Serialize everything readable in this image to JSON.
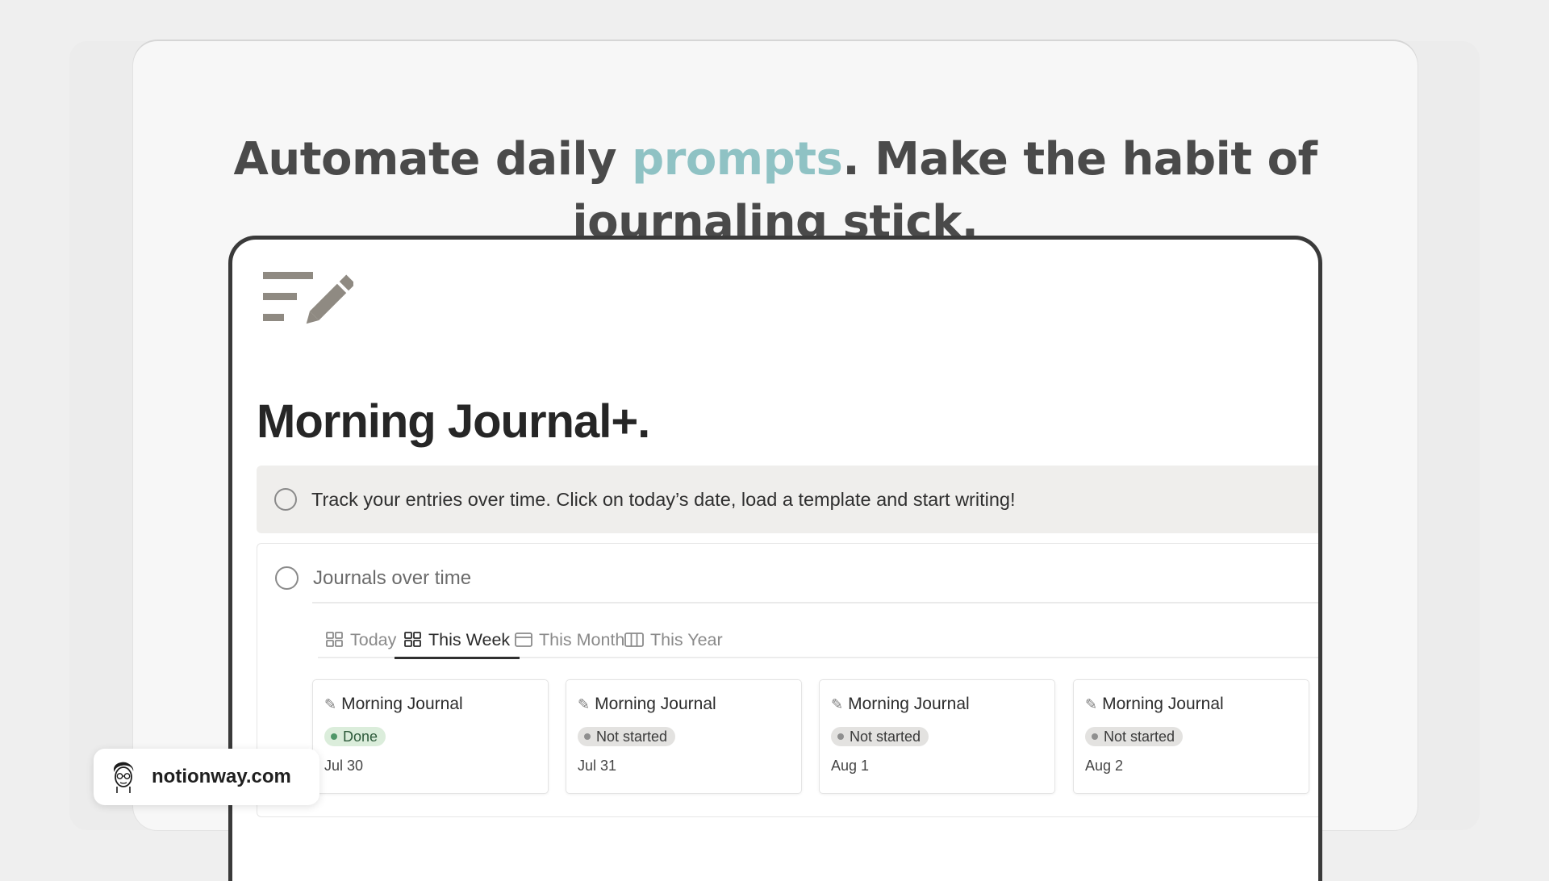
{
  "headline": {
    "part1": "Automate daily ",
    "accent": "prompts",
    "part2": ". Make the habit of",
    "line2": "journaling stick."
  },
  "colors": {
    "accent": "#8fc2c4",
    "done_badge_bg": "#dbeddb",
    "not_started_badge_bg": "#e3e2e0"
  },
  "app": {
    "page_icon": "pencil-lines-icon",
    "page_title": "Morning Journal+.",
    "callout": {
      "icon": "circle-icon",
      "text": "Track your entries over time. Click on today’s date, load a template and start writing!"
    },
    "database": {
      "title": "Journals over time",
      "tabs": [
        {
          "label": "Today",
          "icon": "gallery-icon",
          "active": false
        },
        {
          "label": "This Week",
          "icon": "gallery-icon",
          "active": true
        },
        {
          "label": "This Month",
          "icon": "calendar-icon",
          "active": false
        },
        {
          "label": "This Year",
          "icon": "board-icon",
          "active": false
        }
      ],
      "cards": [
        {
          "title": "Morning Journal",
          "status": "Done",
          "date": "Jul 30"
        },
        {
          "title": "Morning Journal",
          "status": "Not started",
          "date": "Jul 31"
        },
        {
          "title": "Morning Journal",
          "status": "Not started",
          "date": "Aug 1"
        },
        {
          "title": "Morning Journal",
          "status": "Not started",
          "date": "Aug 2"
        }
      ]
    }
  },
  "brand": {
    "avatar": "avatar-icon",
    "text": "notionway.com"
  }
}
